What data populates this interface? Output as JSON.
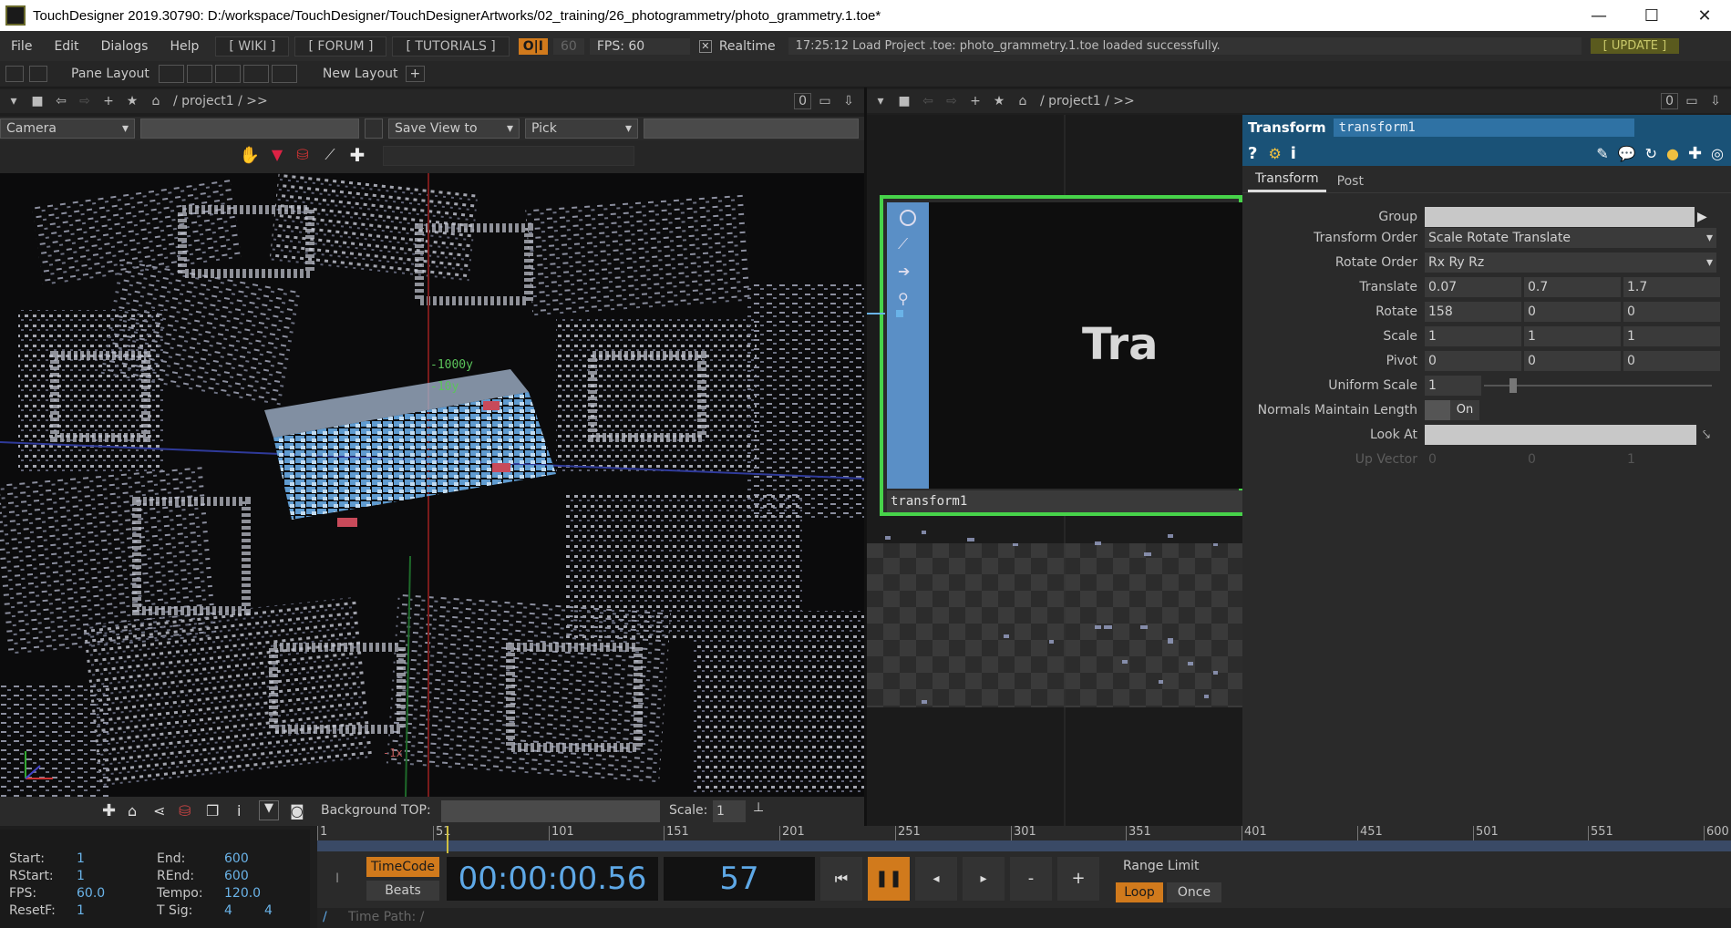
{
  "window": {
    "title": "TouchDesigner 2019.30790: D:/workspace/TouchDesigner/TouchDesignerArtworks/02_training/26_photogrammetry/photo_grammetry.1.toe*",
    "minimize": "—",
    "maximize": "☐",
    "close": "✕"
  },
  "menu": {
    "file": "File",
    "edit": "Edit",
    "dialogs": "Dialogs",
    "help": "Help",
    "wiki": "[ WIKI ]",
    "forum": "[ FORUM ]",
    "tutorials": "[ TUTORIALS ]",
    "oi": "O|I",
    "fps_limit": "60",
    "fps": "FPS:  60",
    "realtime": "Realtime",
    "status": "17:25:12 Load Project .toe: photo_grammetry.1.toe loaded successfully.",
    "update": "[ UPDATE ]"
  },
  "panebar": {
    "pane_layout": "Pane Layout",
    "new_layout": "New Layout",
    "plus": "+"
  },
  "left_path": {
    "zero": "0",
    "path": "/ project1 / >>"
  },
  "right_path": {
    "zero": "0",
    "path": "/ project1 / >>"
  },
  "viewer": {
    "camera": "Camera",
    "save_view": "Save View to",
    "pick": "Pick",
    "axis_y1": "-1000y",
    "axis_y2": "-10y",
    "axis_x": "-1x",
    "background_top_label": "Background TOP:",
    "scale_label": "Scale:",
    "scale_value": "1"
  },
  "network": {
    "preview_text": "Tra",
    "node_name": "transform1"
  },
  "params": {
    "op_type": "Transform",
    "op_name": "transform1",
    "tabs": [
      "Transform",
      "Post"
    ],
    "rows": [
      {
        "label": "Group",
        "values": [
          ""
        ]
      },
      {
        "label": "Transform Order",
        "values": [
          "Scale Rotate Translate"
        ]
      },
      {
        "label": "Rotate Order",
        "values": [
          "Rx Ry Rz"
        ]
      },
      {
        "label": "Translate",
        "values": [
          "0.07",
          "0.7",
          "1.7"
        ]
      },
      {
        "label": "Rotate",
        "values": [
          "158",
          "0",
          "0"
        ]
      },
      {
        "label": "Scale",
        "values": [
          "1",
          "1",
          "1"
        ]
      },
      {
        "label": "Pivot",
        "values": [
          "0",
          "0",
          "0"
        ]
      },
      {
        "label": "Uniform Scale",
        "values": [
          "1"
        ]
      },
      {
        "label": "Normals Maintain Length",
        "values": [
          "On"
        ]
      },
      {
        "label": "Look At",
        "values": [
          ""
        ]
      },
      {
        "label": "Up Vector",
        "values": [
          "0",
          "0",
          "1"
        ]
      }
    ]
  },
  "timeline": {
    "ticks": [
      "1",
      "51",
      "101",
      "151",
      "201",
      "251",
      "301",
      "351",
      "401",
      "451",
      "501",
      "551",
      "600"
    ]
  },
  "info": {
    "start_k": "Start:",
    "start_v": "1",
    "end_k": "End:",
    "end_v": "600",
    "rstart_k": "RStart:",
    "rstart_v": "1",
    "rend_k": "REnd:",
    "rend_v": "600",
    "fps_k": "FPS:",
    "fps_v": "60.0",
    "tempo_k": "Tempo:",
    "tempo_v": "120.0",
    "resetf_k": "ResetF:",
    "resetf_v": "1",
    "tsig_k": "T Sig:",
    "tsig_v1": "4",
    "tsig_v2": "4"
  },
  "transport": {
    "timecode": "TimeCode",
    "beats": "Beats",
    "time": "00:00:00.56",
    "frame": "57",
    "minus": "-",
    "plus": "+",
    "range_limit": "Range Limit",
    "loop": "Loop",
    "once": "Once",
    "i_label": "I"
  },
  "timepath": {
    "slash": "/",
    "label": "Time Path: /"
  }
}
